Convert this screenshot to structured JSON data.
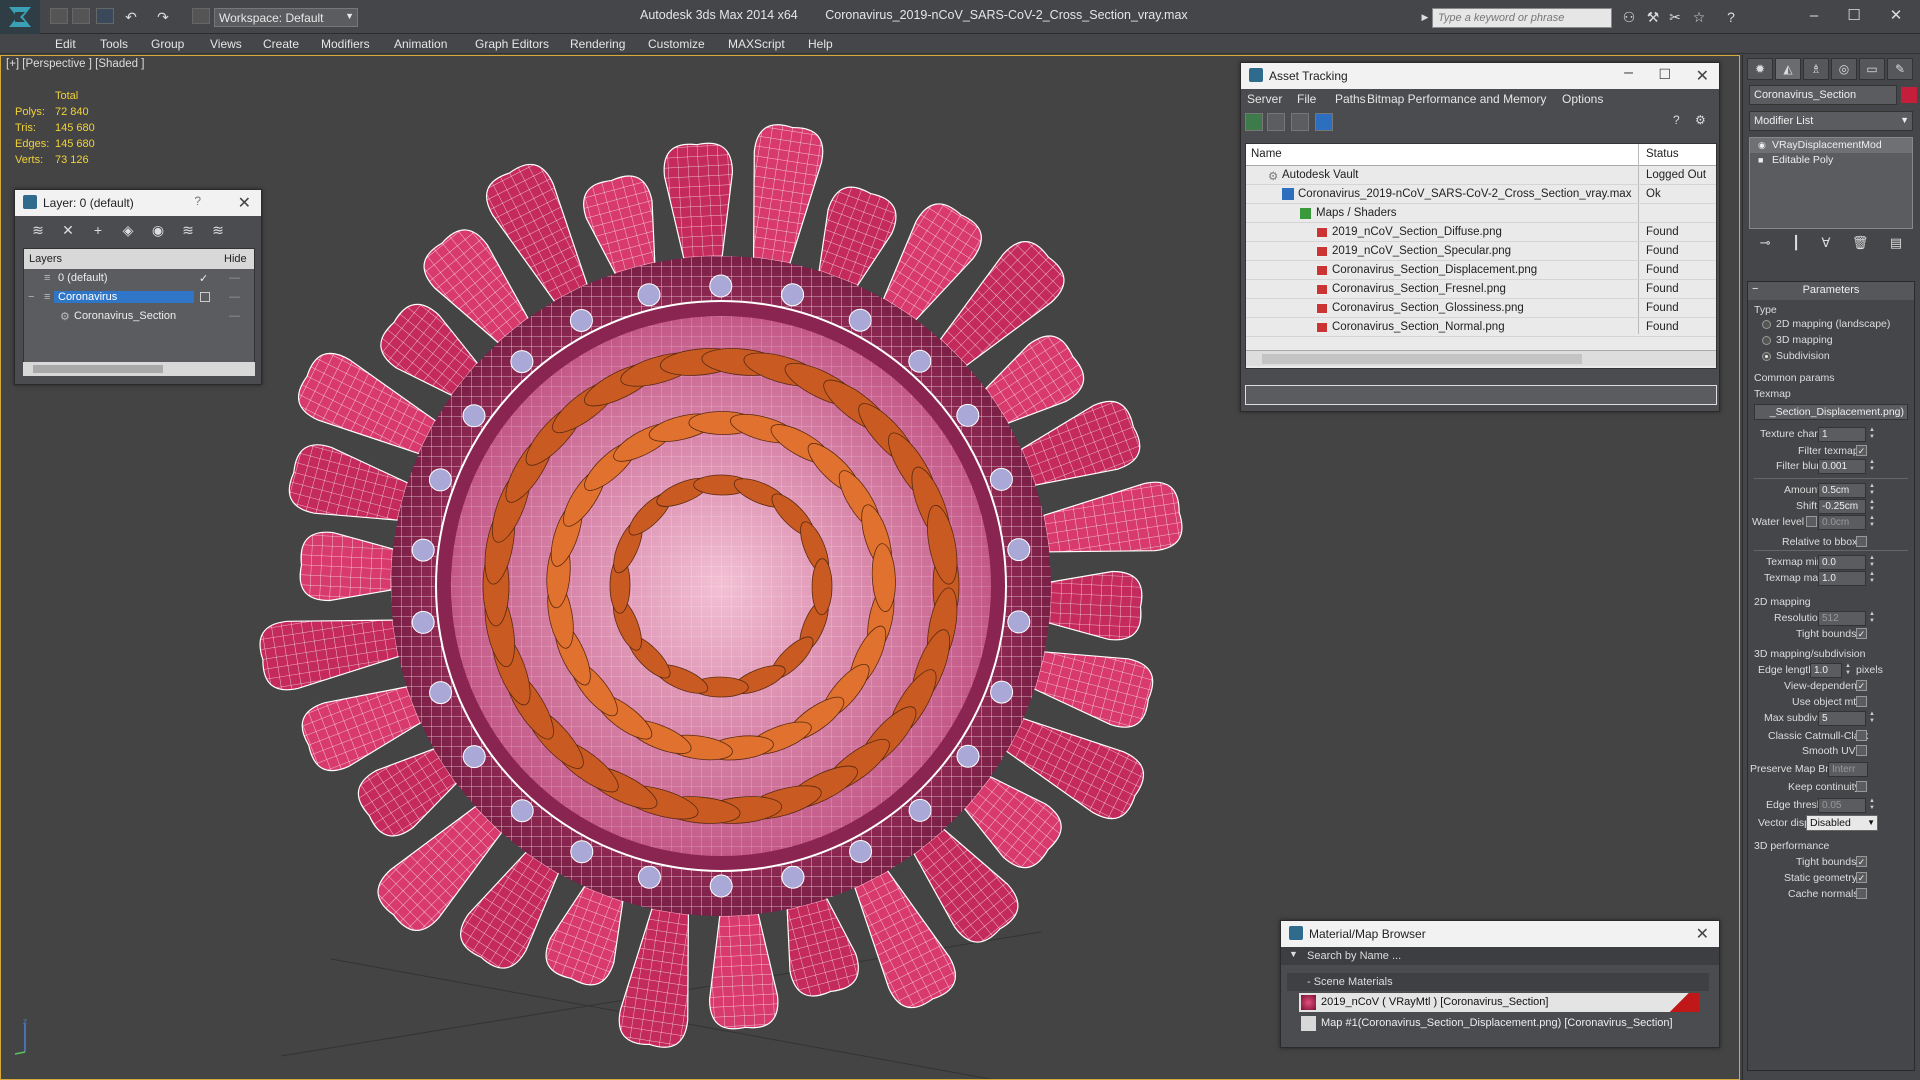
{
  "window": {
    "app_name": "Autodesk 3ds Max  2014 x64",
    "file_name": "Coronavirus_2019-nCoV_SARS-CoV-2_Cross_Section_vray.max",
    "workspace_label": "Workspace: Default",
    "search_placeholder": "Type a keyword or phrase"
  },
  "menu": [
    "Edit",
    "Tools",
    "Group",
    "Views",
    "Create",
    "Modifiers",
    "Animation",
    "Graph Editors",
    "Rendering",
    "Customize",
    "MAXScript",
    "Help"
  ],
  "viewport": {
    "label": "[+] [Perspective ] [Shaded ]",
    "stats": {
      "total_label": "Total",
      "rows": [
        {
          "label": "Polys:",
          "value": "72 840"
        },
        {
          "label": "Tris:",
          "value": "145 680"
        },
        {
          "label": "Edges:",
          "value": "145 680"
        },
        {
          "label": "Verts:",
          "value": "73 126"
        }
      ]
    }
  },
  "layer_window": {
    "title": "Layer: 0 (default)",
    "help": "?",
    "col_layers": "Layers",
    "col_hide": "Hide",
    "rows": [
      {
        "name": "0 (default)",
        "check": "✓"
      },
      {
        "name": "Coronavirus",
        "check": ""
      },
      {
        "name": "Coronavirus_Section",
        "check": ""
      }
    ]
  },
  "asset_tracking": {
    "title": "Asset Tracking",
    "menu": [
      "Server",
      "File",
      "Paths",
      "Bitmap Performance and Memory",
      "Options"
    ],
    "col_name": "Name",
    "col_status": "Status",
    "rows": [
      {
        "name": "Autodesk Vault",
        "status": "Logged Out"
      },
      {
        "name": "Coronavirus_2019-nCoV_SARS-CoV-2_Cross_Section_vray.max",
        "status": "Ok"
      },
      {
        "name": "Maps / Shaders",
        "status": ""
      },
      {
        "name": "2019_nCoV_Section_Diffuse.png",
        "status": "Found"
      },
      {
        "name": "2019_nCoV_Section_Specular.png",
        "status": "Found"
      },
      {
        "name": "Coronavirus_Section_Displacement.png",
        "status": "Found"
      },
      {
        "name": "Coronavirus_Section_Fresnel.png",
        "status": "Found"
      },
      {
        "name": "Coronavirus_Section_Glossiness.png",
        "status": "Found"
      },
      {
        "name": "Coronavirus_Section_Normal.png",
        "status": "Found"
      }
    ]
  },
  "material_browser": {
    "title": "Material/Map Browser",
    "search_placeholder": "Search by Name ...",
    "group_label": "- Scene Materials",
    "items": [
      "2019_nCoV  ( VRayMtl ) [Coronavirus_Section]",
      "Map #1(Coronavirus_Section_Displacement.png) [Coronavirus_Section]"
    ]
  },
  "command_panel": {
    "object_name": "Coronavirus_Section",
    "object_color": "#c41e3a",
    "modifier_list_label": "Modifier List",
    "stack": [
      "VRayDisplacementMod",
      "Editable Poly"
    ],
    "parameters_title": "Parameters",
    "type_label": "Type",
    "type_options": [
      "2D mapping (landscape)",
      "3D mapping",
      "Subdivision"
    ],
    "type_selected": 2,
    "common_params_label": "Common params",
    "texmap_label": "Texmap",
    "texmap_value": "_Section_Displacement.png)",
    "texture_chan_label": "Texture chan",
    "texture_chan_value": "1",
    "filter_texmap_label": "Filter texmap",
    "filter_blur_label": "Filter blur",
    "filter_blur_value": "0.001",
    "amount_label": "Amount",
    "amount_value": "0.5cm",
    "shift_label": "Shift",
    "shift_value": "-0.25cm",
    "water_level_label": "Water level",
    "water_level_value": "0.0cm",
    "relative_bbox_label": "Relative to bbox",
    "texmap_min_label": "Texmap min",
    "texmap_min_value": "0.0",
    "texmap_max_label": "Texmap max",
    "texmap_max_value": "1.0",
    "mapping2d_label": "2D mapping",
    "resolution_label": "Resolution",
    "resolution_value": "512",
    "tight_bounds_label": "Tight bounds",
    "mapping3d_label": "3D mapping/subdivision",
    "edge_length_label": "Edge length",
    "edge_length_value": "1.0",
    "pixels_label": "pixels",
    "view_dependent_label": "View-dependent",
    "use_object_mtl_label": "Use object mtl",
    "max_subdivs_label": "Max subdivs",
    "max_subdivs_value": "5",
    "classic_cc_label": "Classic Catmull-Clark",
    "smooth_uvs_label": "Smooth UVs",
    "preserve_map_label": "Preserve Map Bnd",
    "preserve_map_value": "Interr",
    "keep_continuity_label": "Keep continuity",
    "edge_thresh_label": "Edge thresh",
    "edge_thresh_value": "0.05",
    "vector_displ_label": "Vector displ",
    "vector_displ_value": "Disabled",
    "performance_label": "3D performance",
    "perf_tight_bounds_label": "Tight bounds",
    "static_geometry_label": "Static geometry",
    "cache_normals_label": "Cache normals"
  },
  "icons": [
    "app-logo-icon",
    "new-file-icon",
    "open-icon",
    "save-icon",
    "undo-icon",
    "redo-icon",
    "binoculars-icon",
    "star-icon",
    "help-icon",
    "minimize-icon",
    "maximize-icon",
    "close-icon"
  ]
}
